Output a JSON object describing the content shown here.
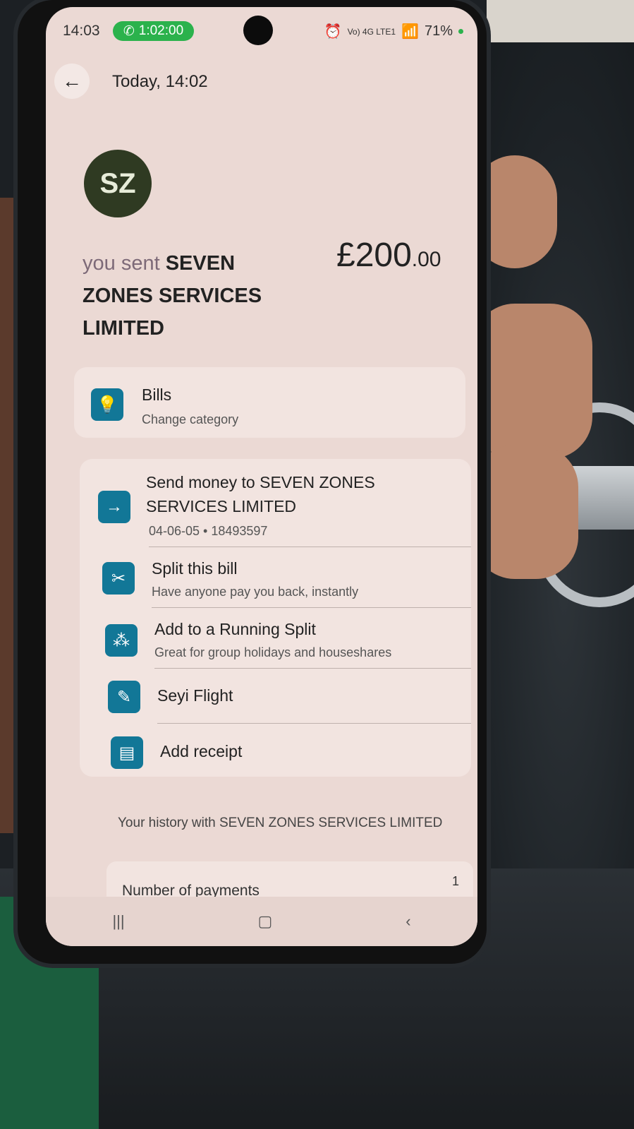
{
  "status": {
    "time": "14:03",
    "call_timer": "1:02:00",
    "network": "Vo) 4G LTE1",
    "battery": "71%"
  },
  "header": {
    "title": "Today, 14:02"
  },
  "payee": {
    "initials": "SZ",
    "prefix": "you sent",
    "name": "SEVEN ZONES SERVICES LIMITED",
    "amount_main": "£200",
    "amount_cents": ".00"
  },
  "category": {
    "title": "Bills",
    "subtitle": "Change category"
  },
  "actions": {
    "send_money": {
      "title": "Send money to SEVEN ZONES SERVICES LIMITED",
      "subtitle": "04-06-05 • 18493597"
    },
    "split_bill": {
      "title": "Split this bill",
      "subtitle": "Have anyone pay you back, instantly"
    },
    "running_split": {
      "title": "Add to a Running Split",
      "subtitle": "Great for group holidays and houseshares"
    },
    "note": {
      "title": "Seyi Flight"
    },
    "receipt": {
      "title": "Add receipt"
    }
  },
  "history": {
    "title": "Your history with SEVEN ZONES SERVICES LIMITED",
    "payments_label": "Number of payments",
    "payments_value": "1"
  },
  "icons": {
    "back": "arrow-left-icon",
    "category": "lightbulb-icon",
    "send": "arrow-right-icon",
    "split": "split-bill-icon",
    "running": "group-icon",
    "note": "pencil-icon",
    "receipt": "receipt-icon"
  },
  "colors": {
    "accent": "#127797",
    "screen_bg": "#ebd9d4",
    "call_green": "#2bb24c"
  }
}
